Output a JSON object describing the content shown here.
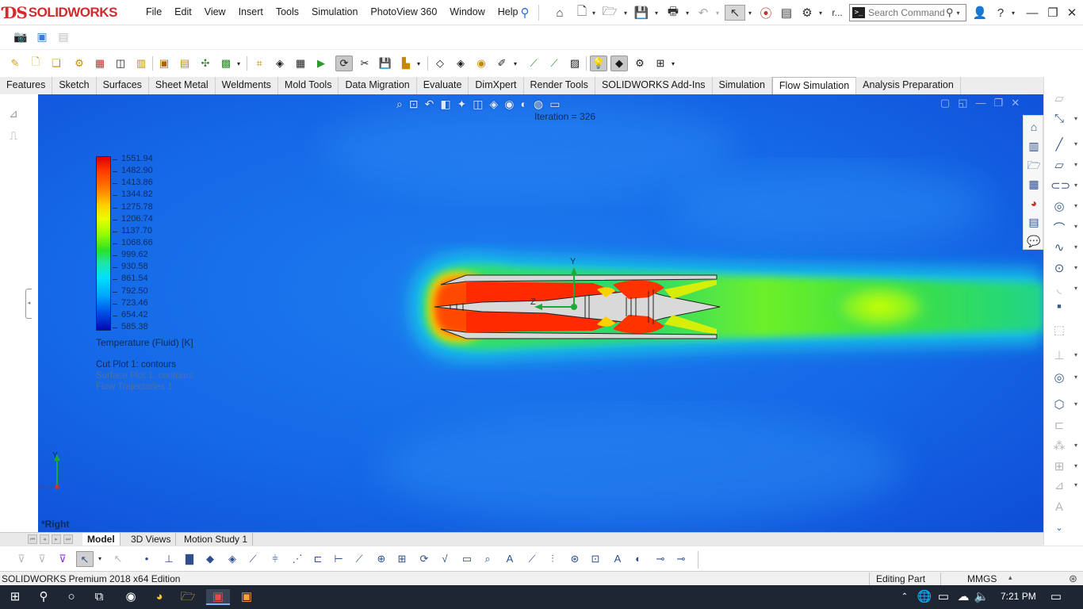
{
  "app": {
    "logo_ds": "ƊS",
    "logo_text": "SOLIDWORKS",
    "menus": [
      "File",
      "Edit",
      "View",
      "Insert",
      "Tools",
      "Simulation",
      "PhotoView 360",
      "Window",
      "Help"
    ],
    "user_overflow": "r...",
    "search": {
      "placeholder": "Search Command"
    }
  },
  "command_tabs": [
    "Features",
    "Sketch",
    "Surfaces",
    "Sheet Metal",
    "Weldments",
    "Mold Tools",
    "Data Migration",
    "Evaluate",
    "DimXpert",
    "Render Tools",
    "SOLIDWORKS Add-Ins",
    "Simulation",
    "Flow Simulation",
    "Analysis Preparation"
  ],
  "active_command_tab": "Flow Simulation",
  "viewport": {
    "iteration": "Iteration = 326",
    "legend": {
      "values": [
        "1551.94",
        "1482.90",
        "1413.86",
        "1344.82",
        "1275.78",
        "1206.74",
        "1137.70",
        "1068.66",
        "999.62",
        "930.58",
        "861.54",
        "792.50",
        "723.46",
        "654.42",
        "585.38"
      ],
      "title": "Temperature (Fluid) [K]"
    },
    "plots": [
      {
        "label": "Cut Plot 1: contours",
        "color": "#0c2c5c"
      },
      {
        "label": "Surface Plot 1: contours",
        "color": "#4f6fa8"
      },
      {
        "label": "Flow Trajectories 1",
        "color": "#4f6fa8"
      }
    ],
    "view_name": "*Right",
    "triad": {
      "y": "Y",
      "z": "Z"
    },
    "model_axes": {
      "y": "Y",
      "z": "Z"
    },
    "colors": {
      "cold": "#1f6fe8",
      "hot": "#ff2a00",
      "warm": "#2fe06a"
    }
  },
  "bottom_tabs": [
    "Model",
    "3D Views",
    "Motion Study 1"
  ],
  "active_bottom_tab": "Model",
  "status": {
    "edition": "SOLIDWORKS Premium 2018 x64 Edition",
    "mode": "Editing Part",
    "units": "MMGS"
  },
  "taskbar": {
    "time": "7:21 PM"
  }
}
